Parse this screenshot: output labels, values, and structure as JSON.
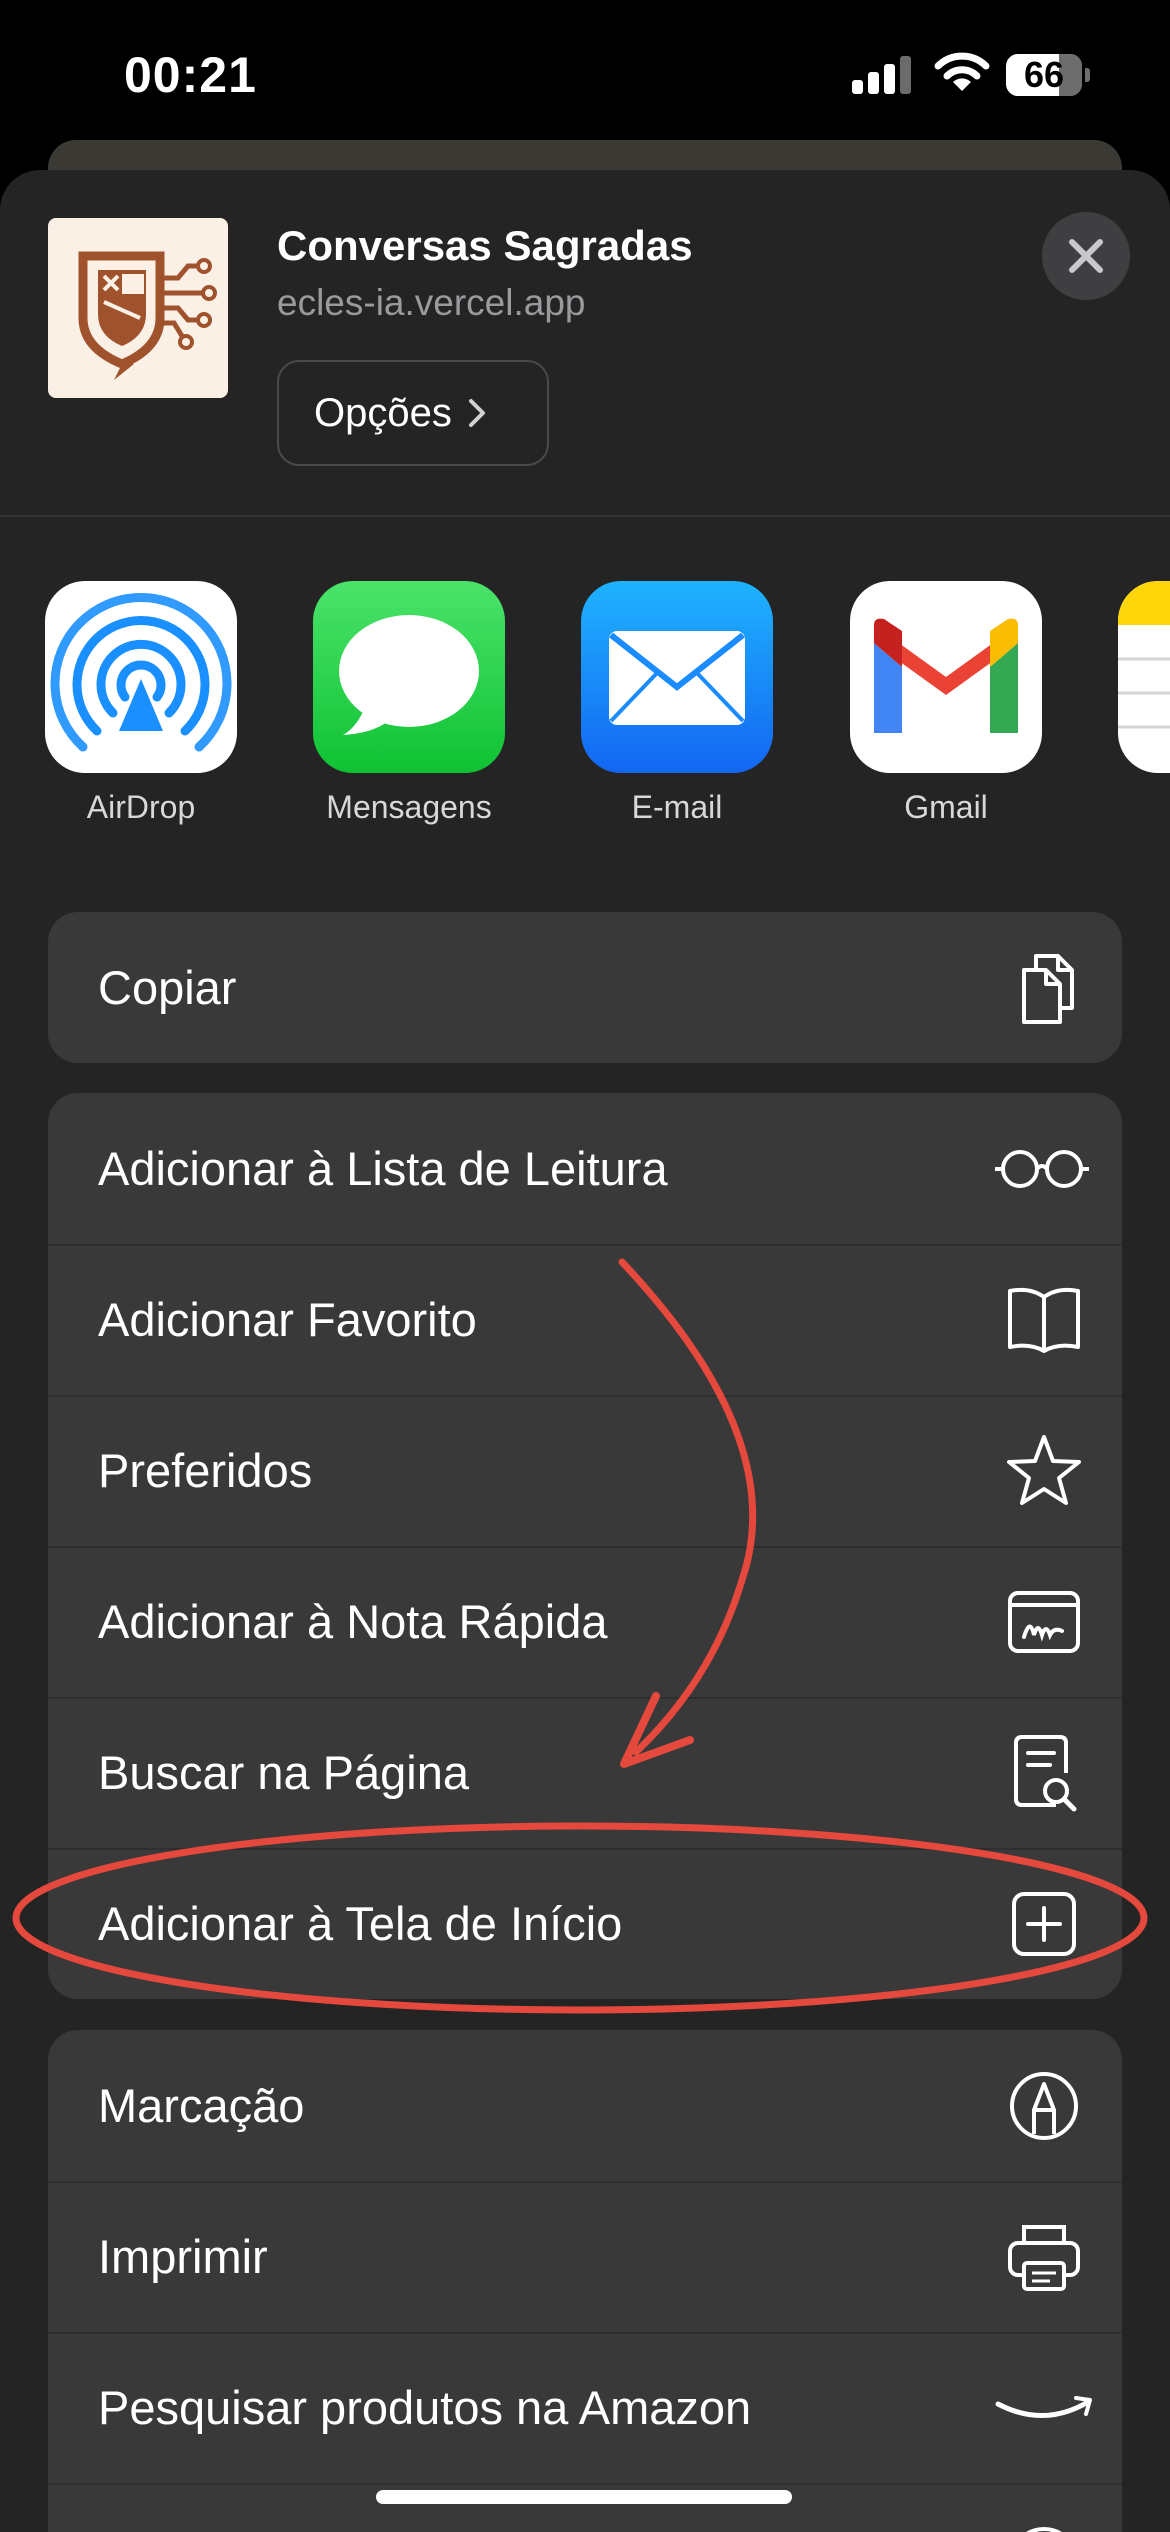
{
  "status_bar": {
    "time": "00:21",
    "battery": "66"
  },
  "share_header": {
    "title": "Conversas Sagradas",
    "url": "ecles-ia.vercel.app",
    "options_label": "Opções",
    "close_icon": "close-icon"
  },
  "share_apps": [
    {
      "label": "AirDrop",
      "icon": "airdrop-icon"
    },
    {
      "label": "Mensagens",
      "icon": "messages-icon"
    },
    {
      "label": "E-mail",
      "icon": "mail-icon"
    },
    {
      "label": "Gmail",
      "icon": "gmail-icon"
    },
    {
      "label": "",
      "icon": "notes-icon"
    }
  ],
  "actions": {
    "group1": [
      {
        "label": "Copiar",
        "icon": "copy-icon"
      }
    ],
    "group2": [
      {
        "label": "Adicionar à Lista de Leitura",
        "icon": "glasses-icon"
      },
      {
        "label": "Adicionar Favorito",
        "icon": "book-icon"
      },
      {
        "label": "Preferidos",
        "icon": "star-icon"
      },
      {
        "label": "Adicionar à Nota Rápida",
        "icon": "quick-note-icon"
      },
      {
        "label": "Buscar na Página",
        "icon": "find-in-page-icon"
      },
      {
        "label": "Adicionar à Tela de Início",
        "icon": "add-square-icon"
      }
    ],
    "group3": [
      {
        "label": "Marcação",
        "icon": "markup-icon"
      },
      {
        "label": "Imprimir",
        "icon": "printer-icon"
      },
      {
        "label": "Pesquisar produtos na Amazon",
        "icon": "amazon-icon"
      }
    ]
  },
  "colors": {
    "sheet_background": "#242424",
    "row_background": "#393939",
    "annotation_red": "#e5483c",
    "messages_green": "#2bd54f",
    "mail_blue": "#1a8cff",
    "airdrop_blue": "#1a8fff"
  }
}
